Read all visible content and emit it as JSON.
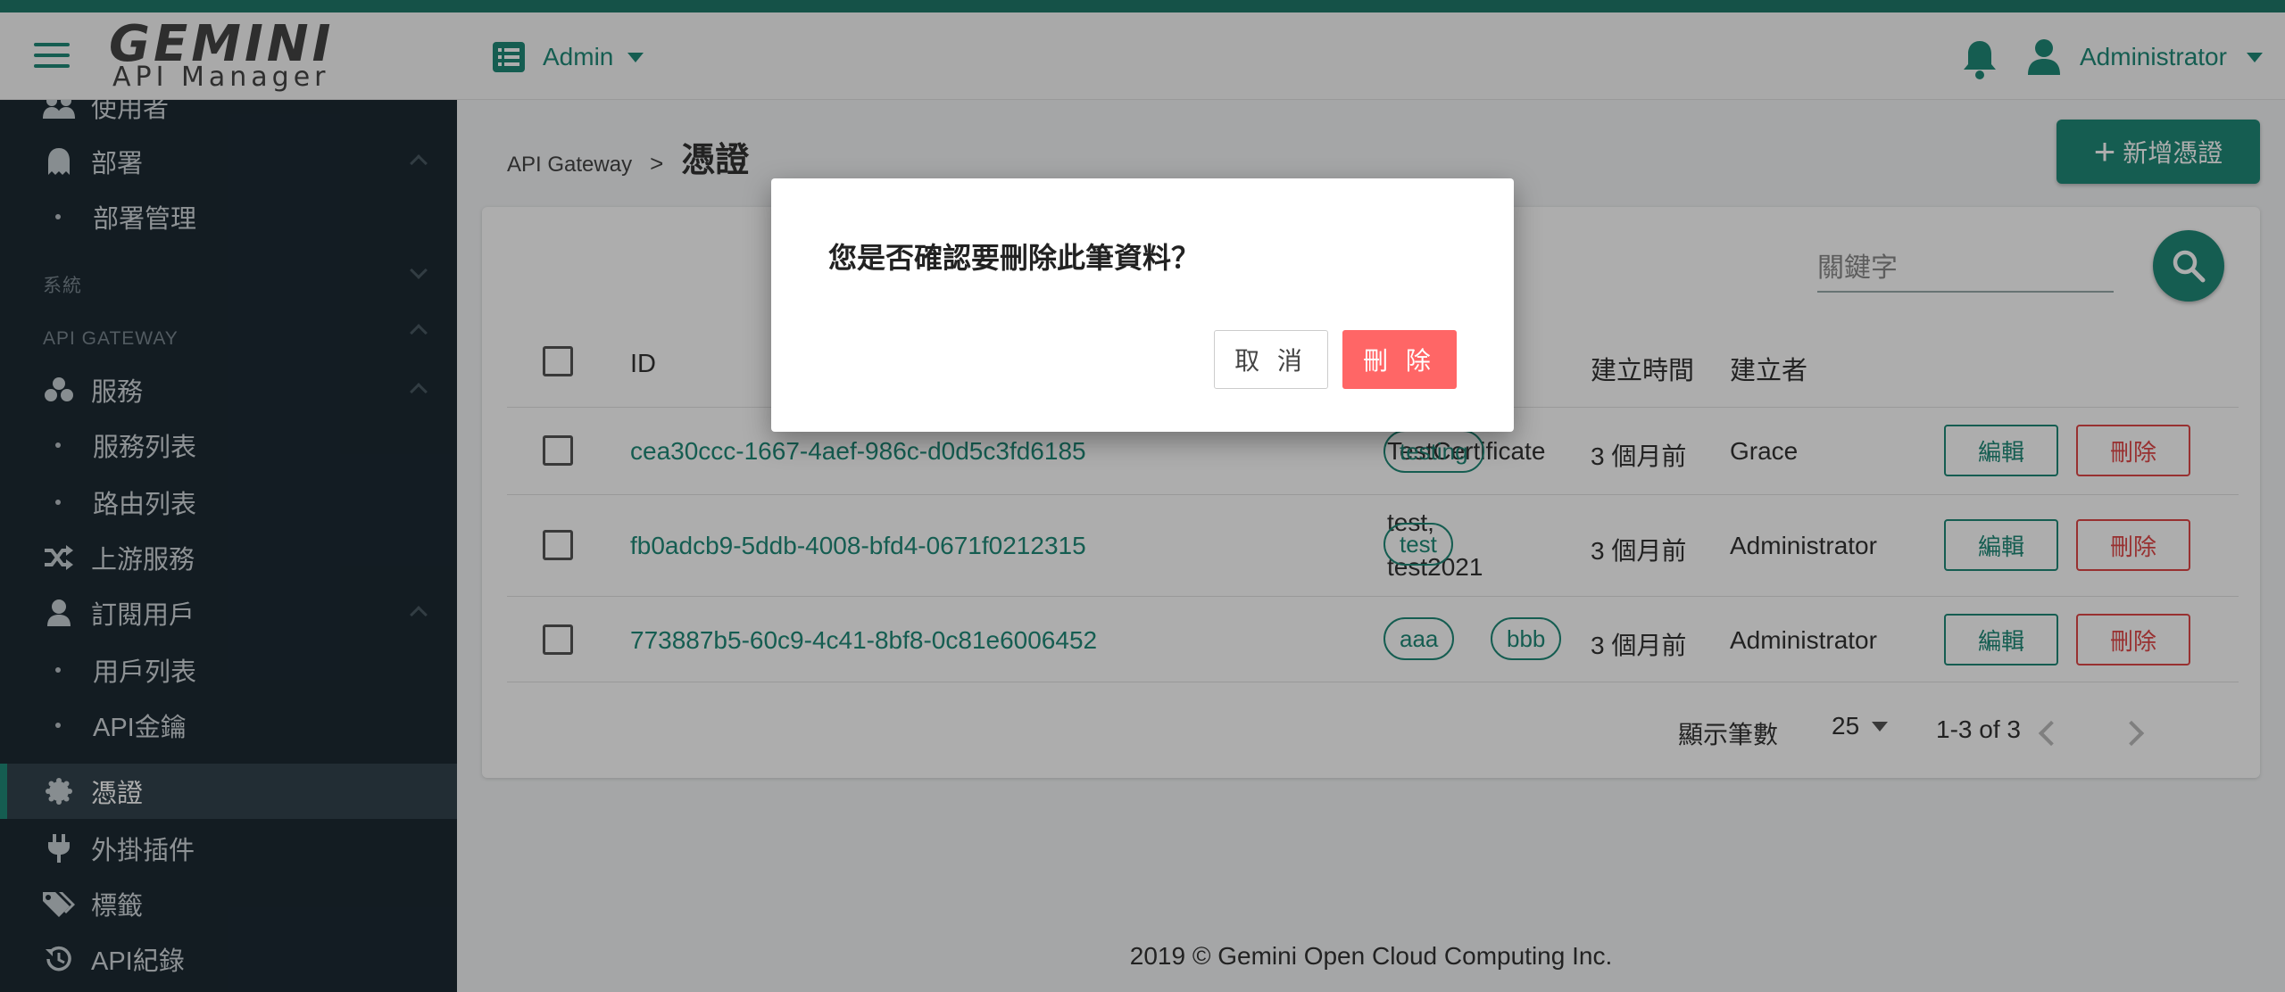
{
  "header": {
    "logo_main": "GEMINI",
    "logo_sub": "API Manager",
    "admin_label": "Admin",
    "user_label": "Administrator"
  },
  "sidebar": {
    "items": [
      {
        "label": "使用者",
        "icon": "users-icon"
      },
      {
        "label": "部署",
        "icon": "deploy-icon"
      },
      {
        "label": "部署管理"
      },
      {
        "label": "服務",
        "icon": "services-icon"
      },
      {
        "label": "服務列表"
      },
      {
        "label": "路由列表"
      },
      {
        "label": "上游服務",
        "icon": "shuffle-icon"
      },
      {
        "label": "訂閱用戶",
        "icon": "user-icon"
      },
      {
        "label": "用戶列表"
      },
      {
        "label": "API金鑰"
      },
      {
        "label": "憑證",
        "icon": "certificate-icon"
      },
      {
        "label": "外掛插件",
        "icon": "plug-icon"
      },
      {
        "label": "標籤",
        "icon": "tags-icon"
      },
      {
        "label": "API紀錄",
        "icon": "history-icon"
      }
    ],
    "sections": {
      "system": "系統",
      "api_gateway": "API GATEWAY"
    },
    "active": "憑證"
  },
  "main": {
    "breadcrumb_parent": "API Gateway",
    "breadcrumb_sep": ">",
    "page_title": "憑證",
    "add_button": "新增憑證",
    "search_placeholder": "關鍵字",
    "table": {
      "headers": {
        "id": "ID",
        "created_time": "建立時間",
        "creator": "建立者"
      },
      "rows": [
        {
          "id": "cea30ccc-1667-4aef-986c-d0d5c3fd6185",
          "snis": [
            "TestCertificate"
          ],
          "tags": [
            "testing"
          ],
          "created": "3 個月前",
          "creator": "Grace"
        },
        {
          "id": "fb0adcb9-5ddb-4008-bfd4-0671f0212315",
          "snis": [
            "test,",
            "test2021"
          ],
          "tags": [
            "test"
          ],
          "created": "3 個月前",
          "creator": "Administrator"
        },
        {
          "id": "773887b5-60c9-4c41-8bf8-0c81e6006452",
          "snis": [],
          "tags": [
            "aaa",
            "bbb"
          ],
          "created": "3 個月前",
          "creator": "Administrator"
        }
      ],
      "edit_label": "編輯",
      "delete_label": "刪除"
    },
    "pager": {
      "rows_label": "顯示筆數",
      "rows_value": "25",
      "range": "1-3 of 3"
    }
  },
  "footer": {
    "text": "2019 © Gemini Open Cloud Computing Inc."
  },
  "dialog": {
    "message": "您是否確認要刪除此筆資料？",
    "cancel": "取 消",
    "confirm": "刪 除"
  },
  "colors": {
    "primary": "#1f8a78",
    "danger": "#e04848",
    "sidebar_bg": "#1c2a33",
    "confirm_bg": "#ff6666"
  }
}
